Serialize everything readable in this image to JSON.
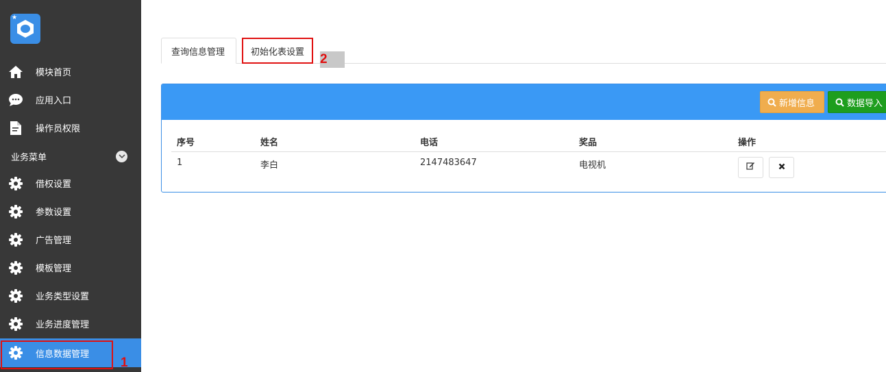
{
  "sidebar": {
    "items": [
      {
        "label": "模块首页",
        "icon": "home-icon"
      },
      {
        "label": "应用入口",
        "icon": "chat-icon"
      },
      {
        "label": "操作员权限",
        "icon": "document-icon"
      }
    ],
    "section_label": "业务菜单",
    "menu": [
      {
        "label": "借权设置",
        "icon": "gear-icon"
      },
      {
        "label": "参数设置",
        "icon": "gear-icon"
      },
      {
        "label": "广告管理",
        "icon": "gear-icon"
      },
      {
        "label": "模板管理",
        "icon": "gear-icon"
      },
      {
        "label": "业务类型设置",
        "icon": "gear-icon"
      },
      {
        "label": "业务进度管理",
        "icon": "gear-icon"
      },
      {
        "label": "信息数据管理",
        "icon": "gear-icon",
        "active": true
      }
    ]
  },
  "tabs": [
    {
      "label": "查询信息管理",
      "active": true
    },
    {
      "label": "初始化表设置",
      "active": false
    }
  ],
  "annotations": {
    "label1": "1",
    "label2": "2"
  },
  "toolbar": {
    "add_label": "新增信息",
    "import_label": "数据导入"
  },
  "table": {
    "headers": [
      "序号",
      "姓名",
      "电话",
      "奖品",
      "操作"
    ],
    "rows": [
      {
        "index": "1",
        "name": "李白",
        "phone": "2147483647",
        "prize": "电视机"
      }
    ]
  },
  "colors": {
    "sidebar_bg": "#383838",
    "accent": "#3a8ee6",
    "panel_head": "#3a99f5",
    "warning": "#f0ad4e",
    "success": "#1e9e1e",
    "highlight": "#e01010"
  }
}
